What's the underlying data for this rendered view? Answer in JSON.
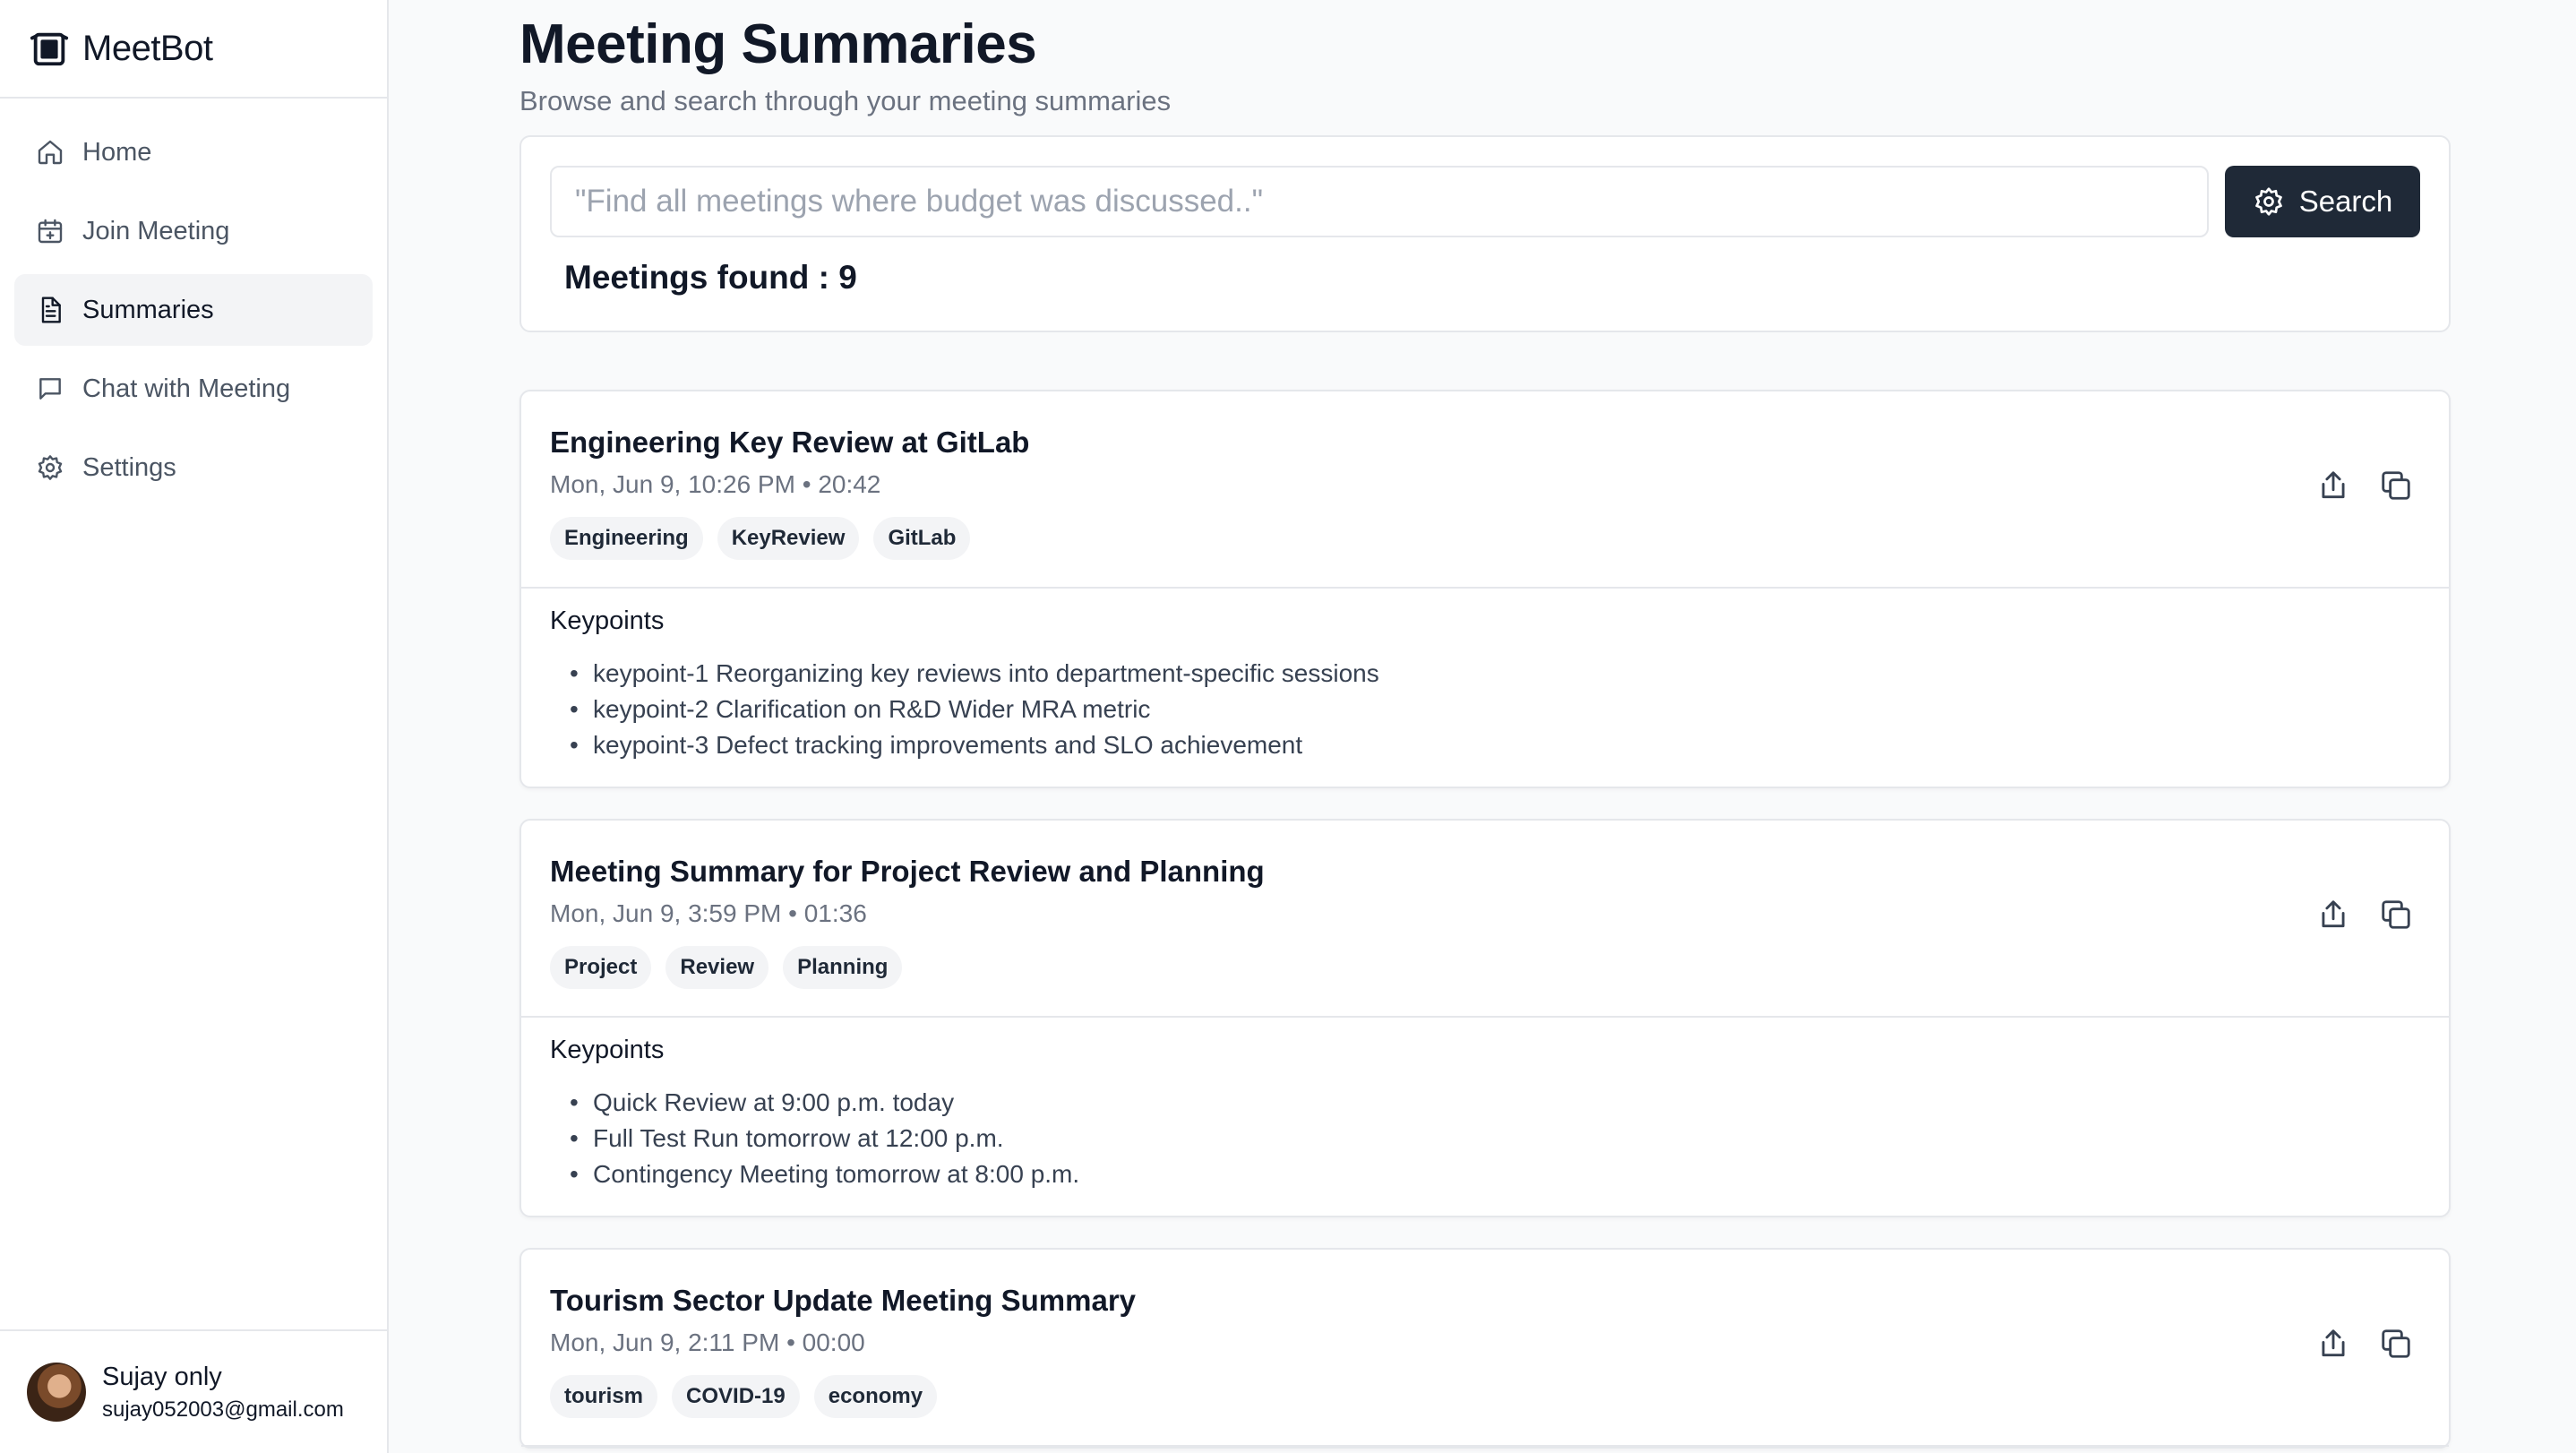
{
  "app": {
    "name": "MeetBot"
  },
  "sidebar": {
    "items": [
      {
        "label": "Home",
        "icon": "home-icon"
      },
      {
        "label": "Join Meeting",
        "icon": "calendar-plus-icon"
      },
      {
        "label": "Summaries",
        "icon": "document-icon",
        "active": true
      },
      {
        "label": "Chat with Meeting",
        "icon": "chat-icon"
      },
      {
        "label": "Settings",
        "icon": "gear-icon"
      }
    ]
  },
  "user": {
    "name": "Sujay only",
    "email": "sujay052003@gmail.com"
  },
  "page": {
    "title": "Meeting Summaries",
    "subtitle": "Browse and search through your meeting summaries"
  },
  "search": {
    "placeholder": "\"Find all meetings where budget was discussed..\"",
    "value": "",
    "button_label": "Search",
    "found_text": "Meetings found : 9"
  },
  "meetings": [
    {
      "title": "Engineering Key Review at GitLab",
      "date": "Mon, Jun 9, 10:26 PM",
      "duration": "20:42",
      "tags": [
        "Engineering",
        "KeyReview",
        "GitLab"
      ],
      "keypoints_heading": "Keypoints",
      "keypoints": [
        "keypoint-1 Reorganizing key reviews into department-specific sessions",
        "keypoint-2 Clarification on R&D Wider MRA metric",
        "keypoint-3 Defect tracking improvements and SLO achievement"
      ]
    },
    {
      "title": "Meeting Summary for Project Review and Planning",
      "date": "Mon, Jun 9, 3:59 PM",
      "duration": "01:36",
      "tags": [
        "Project",
        "Review",
        "Planning"
      ],
      "keypoints_heading": "Keypoints",
      "keypoints": [
        "Quick Review at 9:00 p.m. today",
        "Full Test Run tomorrow at 12:00 p.m.",
        "Contingency Meeting tomorrow at 8:00 p.m."
      ]
    },
    {
      "title": "Tourism Sector Update Meeting Summary",
      "date": "Mon, Jun 9, 2:11 PM",
      "duration": "00:00",
      "tags": [
        "tourism",
        "COVID-19",
        "economy"
      ],
      "keypoints_heading": "",
      "keypoints": []
    }
  ],
  "colors": {
    "accent": "#1f2937",
    "background": "#f9fafb",
    "border": "#e5e7eb",
    "muted_text": "#6b7280",
    "tag_bg": "#f3f4f6"
  }
}
